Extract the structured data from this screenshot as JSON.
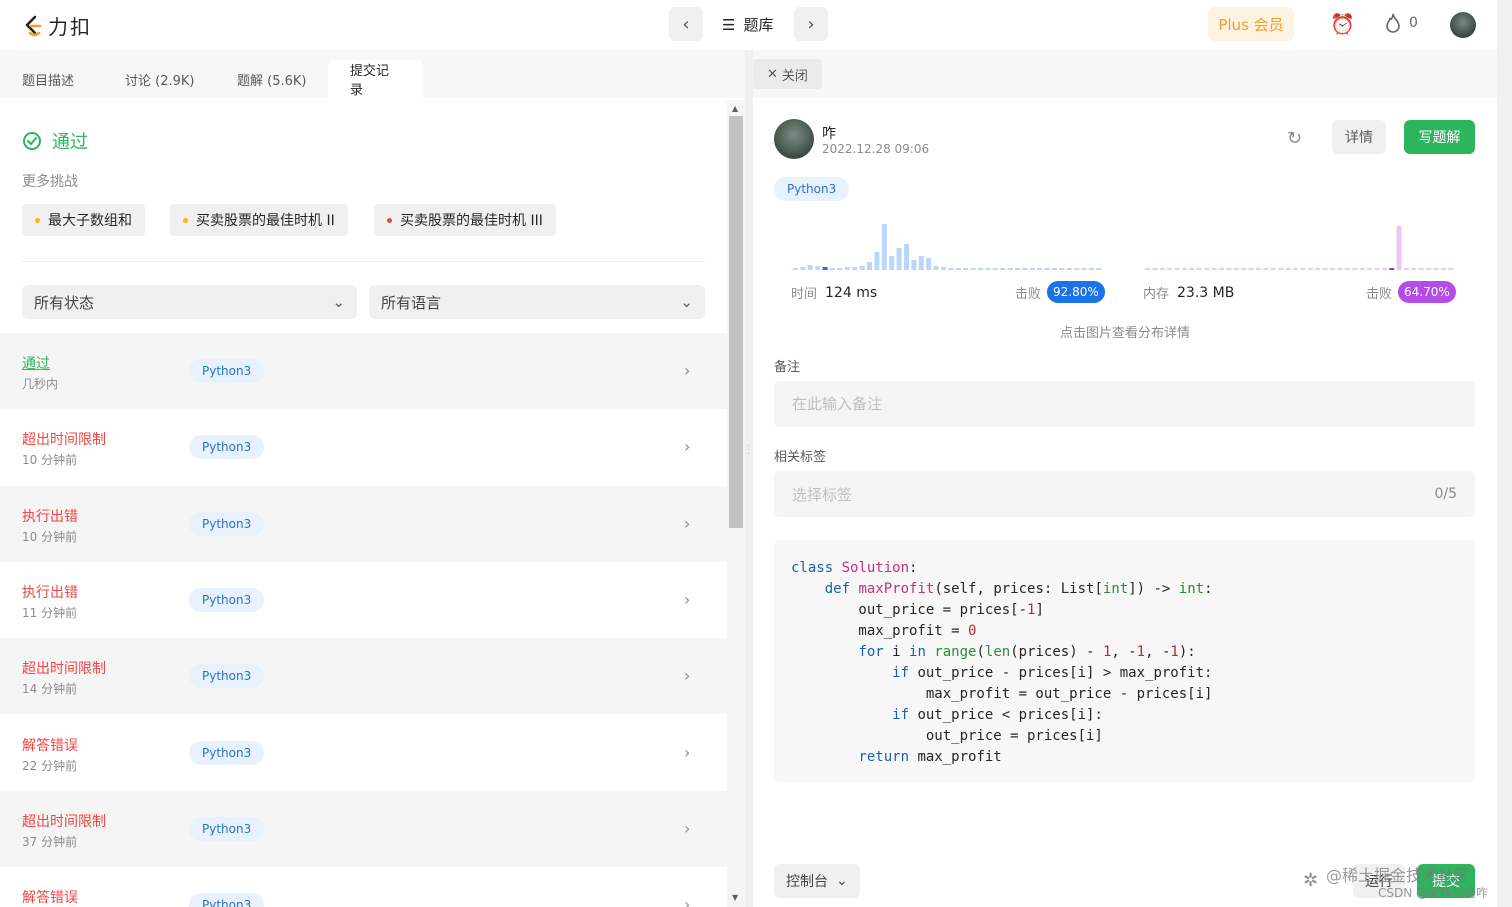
{
  "brand": {
    "name": "力扣"
  },
  "topbar": {
    "problems_label": "题库",
    "plus_label": "Plus 会员",
    "streak_count": "0"
  },
  "tabs": [
    {
      "label": "题目描述"
    },
    {
      "label": "讨论 (2.9K)"
    },
    {
      "label": "题解 (5.6K)"
    },
    {
      "label": "提交记录"
    }
  ],
  "result": {
    "status": "通过",
    "more_label": "更多挑战",
    "challenges": [
      {
        "label": "最大子数组和",
        "color": "#ffb800"
      },
      {
        "label": "买卖股票的最佳时机 II",
        "color": "#ffb800"
      },
      {
        "label": "买卖股票的最佳时机 III",
        "color": "#ef4743"
      }
    ]
  },
  "filters": {
    "status": "所有状态",
    "language": "所有语言"
  },
  "submissions": [
    {
      "status": "通过",
      "time": "几秒内",
      "lang": "Python3",
      "color": "#2db55d"
    },
    {
      "status": "超出时间限制",
      "time": "10 分钟前",
      "lang": "Python3",
      "color": "#ef4743"
    },
    {
      "status": "执行出错",
      "time": "10 分钟前",
      "lang": "Python3",
      "color": "#ef4743"
    },
    {
      "status": "执行出错",
      "time": "11 分钟前",
      "lang": "Python3",
      "color": "#ef4743"
    },
    {
      "status": "超出时间限制",
      "time": "14 分钟前",
      "lang": "Python3",
      "color": "#ef4743"
    },
    {
      "status": "解答错误",
      "time": "22 分钟前",
      "lang": "Python3",
      "color": "#ef4743"
    },
    {
      "status": "超出时间限制",
      "time": "37 分钟前",
      "lang": "Python3",
      "color": "#ef4743"
    },
    {
      "status": "解答错误",
      "time": "",
      "lang": "Python3",
      "color": "#ef4743"
    }
  ],
  "detail": {
    "close_label": "关闭",
    "user_name": "咋",
    "date": "2022.12.28 09:06",
    "detail_button": "详情",
    "write_button": "写题解",
    "lang": "Python3",
    "runtime_label": "时间",
    "runtime_value": "124 ms",
    "runtime_beat_label": "击败",
    "runtime_beat": "92.80%",
    "memory_label": "内存",
    "memory_value": "23.3 MB",
    "memory_beat_label": "击败",
    "memory_beat": "64.70%",
    "hint": "点击图片查看分布详情",
    "note_label": "备注",
    "note_placeholder": "在此输入备注",
    "tags_label": "相关标签",
    "tags_placeholder": "选择标签",
    "tags_count": "0/5"
  },
  "code": [
    "class Solution:",
    "    def maxProfit(self, prices: List[int]) -> int:",
    "        out_price = prices[-1]",
    "        max_profit = 0",
    "        for i in range(len(prices) - 1, -1, -1):",
    "            if out_price - prices[i] > max_profit:",
    "                max_profit = out_price - prices[i]",
    "            if out_price < prices[i]:",
    "                out_price = prices[i]",
    "        return max_profit"
  ],
  "bottom": {
    "console_label": "控制台",
    "run_label": "运行",
    "submit_label": "提交"
  },
  "watermark": {
    "line1": "@稀土掘金技术社区",
    "line2": "CSDN @爱睡觉的咋"
  },
  "colors": {
    "accent_green": "#2db55d",
    "error_red": "#ef4743",
    "runtime_blue": "#1a73e8",
    "memory_purple": "#b44ce6"
  }
}
